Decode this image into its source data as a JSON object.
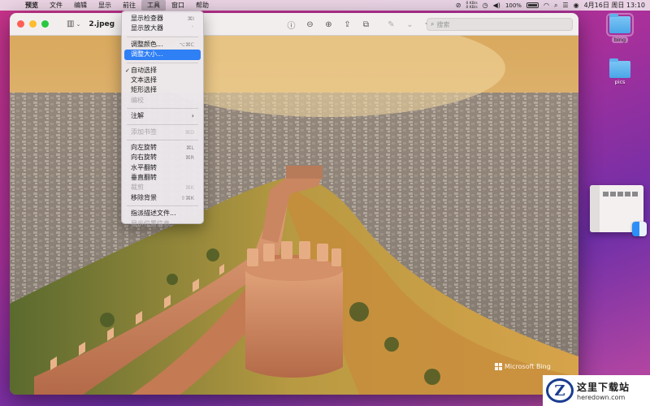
{
  "menubar": {
    "app_name": "预览",
    "items": [
      "文件",
      "编辑",
      "显示",
      "前往",
      "工具",
      "窗口",
      "帮助"
    ],
    "active_index": 4,
    "net_up": "0 KB/s",
    "net_down": "0 KB/s",
    "battery": "100%",
    "clock": "4月16日 周日  13:10"
  },
  "window": {
    "title": "2.jpeg",
    "search_placeholder": "搜索"
  },
  "photo": {
    "watermark": "Microsoft Bing"
  },
  "tools_menu": {
    "items": [
      {
        "label": "显示检查器",
        "shortcut": "⌘I",
        "disabled": false,
        "checked": false
      },
      {
        "label": "显示放大器",
        "shortcut": "`",
        "disabled": false,
        "checked": false
      },
      {
        "separator": true
      },
      {
        "label": "调整颜色...",
        "shortcut": "⌥⌘C",
        "disabled": false,
        "checked": false
      },
      {
        "label": "调整大小...",
        "shortcut": "",
        "disabled": false,
        "checked": false,
        "highlighted": true
      },
      {
        "separator": true
      },
      {
        "label": "自动选择",
        "shortcut": "",
        "disabled": false,
        "checked": true
      },
      {
        "label": "文本选择",
        "shortcut": "",
        "disabled": false,
        "checked": false
      },
      {
        "label": "矩形选择",
        "shortcut": "",
        "disabled": false,
        "checked": false
      },
      {
        "label": "编校",
        "shortcut": "",
        "disabled": true,
        "checked": false
      },
      {
        "separator": true
      },
      {
        "label": "注解",
        "shortcut": "",
        "disabled": false,
        "checked": false,
        "submenu": true
      },
      {
        "separator": true
      },
      {
        "label": "添加书签",
        "shortcut": "⌘D",
        "disabled": true,
        "checked": false
      },
      {
        "separator": true
      },
      {
        "label": "向左旋转",
        "shortcut": "⌘L",
        "disabled": false,
        "checked": false
      },
      {
        "label": "向右旋转",
        "shortcut": "⌘R",
        "disabled": false,
        "checked": false
      },
      {
        "label": "水平翻转",
        "shortcut": "",
        "disabled": false,
        "checked": false
      },
      {
        "label": "垂直翻转",
        "shortcut": "",
        "disabled": false,
        "checked": false
      },
      {
        "label": "裁剪",
        "shortcut": "⌘K",
        "disabled": true,
        "checked": false
      },
      {
        "label": "移除背景",
        "shortcut": "⇧⌘K",
        "disabled": false,
        "checked": false
      },
      {
        "separator": true
      },
      {
        "label": "指派描述文件...",
        "shortcut": "",
        "disabled": false,
        "checked": false
      },
      {
        "label": "显示位置信息",
        "shortcut": "",
        "disabled": true,
        "checked": false
      }
    ]
  },
  "desktop": {
    "folders": [
      {
        "label": "bing",
        "selected": true
      },
      {
        "label": "pics",
        "selected": false
      }
    ]
  },
  "site_watermark": {
    "logo_letter": "Z",
    "cn": "这里下载站",
    "en": "heredown.com"
  },
  "colors": {
    "highlight": "#2f7ff5",
    "wall": "#d99a72",
    "sky": "#e8b46a"
  }
}
